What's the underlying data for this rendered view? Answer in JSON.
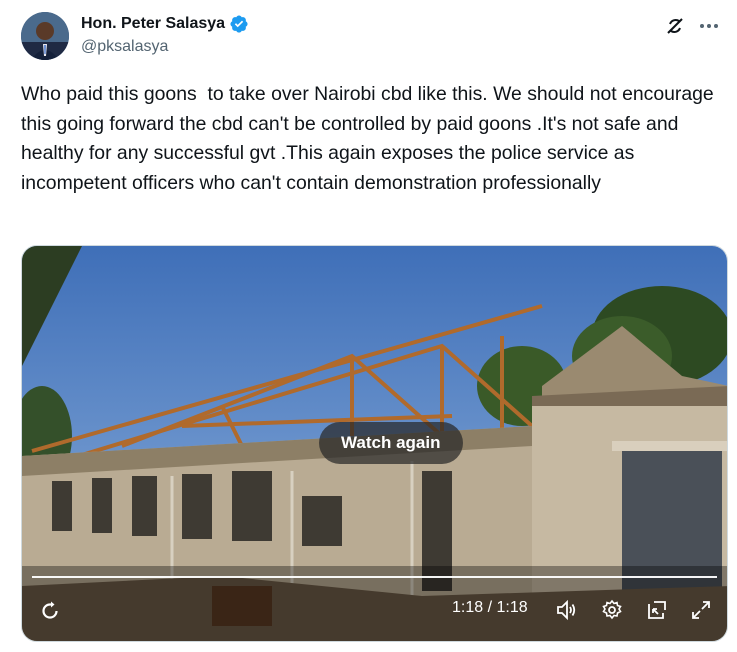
{
  "author": {
    "name": "Hon. Peter Salasya",
    "handle": "@pksalasya",
    "verified": true,
    "verified_color": "#1d9bf0"
  },
  "header_icons": [
    "grok-icon",
    "more-icon"
  ],
  "tweet": {
    "text": "Who paid this goons  to take over Nairobi cbd like this. We should not encourage this going forward the cbd can't be controlled by paid goons .It's not safe and healthy for any successful gvt .This again exposes the police service as incompetent officers who can't contain demonstration professionally"
  },
  "video": {
    "overlay_button": "Watch again",
    "time_display": "1:18 / 1:18",
    "progress": 1.0,
    "controls": [
      "replay-icon",
      "volume-icon",
      "settings-icon",
      "pip-icon",
      "fullscreen-icon"
    ]
  }
}
